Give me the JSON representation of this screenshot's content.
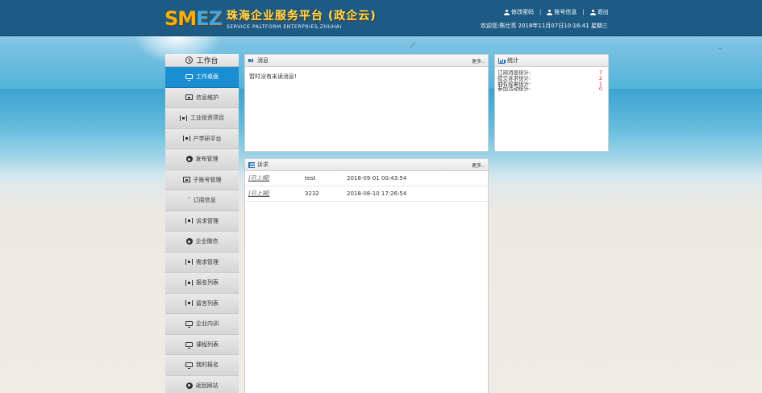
{
  "header": {
    "logo_mark_left": "SM",
    "logo_mark_right": "EZ",
    "title_cn": "珠海企业服务平台 (政企云)",
    "title_en": "SERVICE PALTFORM ENTERPRIES,ZHUHAI",
    "links": [
      {
        "label": "修改密码",
        "icon": "user-icon"
      },
      {
        "label": "账号信息",
        "icon": "user-icon"
      },
      {
        "label": "退出",
        "icon": "user-icon"
      }
    ],
    "separator": "|",
    "welcome": "欢迎您:陈仕亮   2018年11月07日10:16:41 星期三"
  },
  "sidebar": {
    "title": "工作台",
    "items": [
      {
        "label": "工作桌面",
        "icon": "monitor-icon",
        "active": true
      },
      {
        "label": "信息维护",
        "icon": "box-icon"
      },
      {
        "label": "工业投资项目",
        "icon": "bracket-icon"
      },
      {
        "label": "产学研平台",
        "icon": "bracket-icon"
      },
      {
        "label": "发布管理",
        "icon": "gear-icon"
      },
      {
        "label": "子账号管理",
        "icon": "box-icon"
      },
      {
        "label": "订阅信息",
        "icon": "rss-icon"
      },
      {
        "label": "诉求管理",
        "icon": "bracket-icon"
      },
      {
        "label": "企业微信",
        "icon": "gear-icon"
      },
      {
        "label": "需求管理",
        "icon": "bracket-icon"
      },
      {
        "label": "报名列表",
        "icon": "bracket-icon"
      },
      {
        "label": "留言列表",
        "icon": "bracket-icon"
      },
      {
        "label": "企业内训",
        "icon": "monitor-icon"
      },
      {
        "label": "课程列表",
        "icon": "monitor-icon"
      },
      {
        "label": "我的报名",
        "icon": "monitor-icon"
      },
      {
        "label": "返回网站",
        "icon": "gear-icon"
      }
    ]
  },
  "messages": {
    "title": "消息",
    "more": "更多..",
    "empty_text": "暂时没有未读消息!"
  },
  "stats": {
    "title": "统计",
    "rows": [
      {
        "label": "订阅消息统计:",
        "value": "7"
      },
      {
        "label": "提交诉求统计:",
        "value": "2"
      },
      {
        "label": "拥有成果统计:",
        "value": "1"
      },
      {
        "label": "参加活动统计:",
        "value": "0"
      }
    ]
  },
  "requests": {
    "title": "诉求",
    "more": "更多..",
    "rows": [
      {
        "status": "[已上报]",
        "name": "test",
        "time": "2018-09-01 00:43:54"
      },
      {
        "status": "[已上报]",
        "name": "3232",
        "time": "2018-08-10 17:26:54"
      }
    ]
  },
  "colors": {
    "topbar": "#1d5a84",
    "active": "#1a8ed1",
    "stat_value": "#e2231a"
  }
}
